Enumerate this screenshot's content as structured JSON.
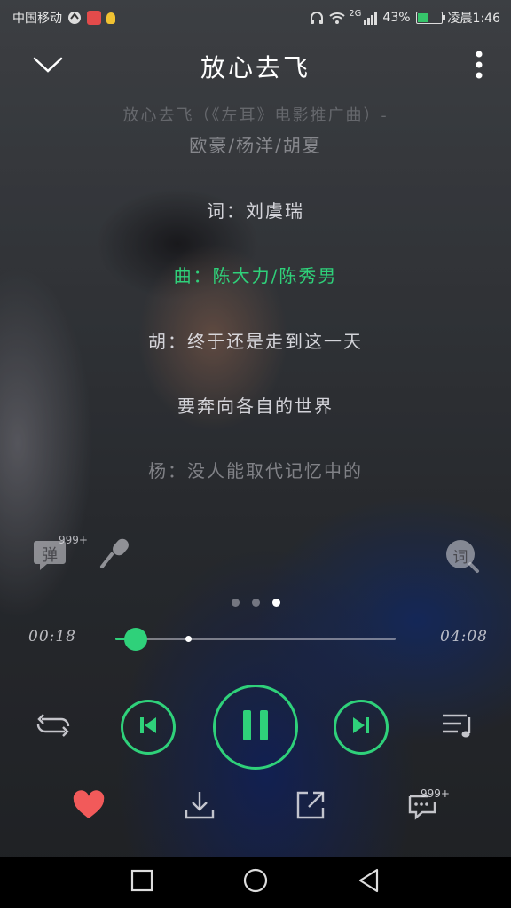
{
  "status_bar": {
    "carrier": "中国移动",
    "network": "2G",
    "battery_text": "43%",
    "battery_level": 0.43,
    "time": "凌晨1:46"
  },
  "header": {
    "title": "放心去飞"
  },
  "lyrics": [
    {
      "text": "放心去飞（《左耳》电影推广曲）-",
      "state": "faded"
    },
    {
      "text": "欧豪/杨洋/胡夏",
      "state": "dim2"
    },
    {
      "text": "词：刘虞瑞",
      "state": "normal"
    },
    {
      "text": "曲：陈大力/陈秀男",
      "state": "active"
    },
    {
      "text": "胡：终于还是走到这一天",
      "state": "normal"
    },
    {
      "text": "要奔向各自的世界",
      "state": "normal"
    },
    {
      "text": "杨：没人能取代记忆中的",
      "state": "dim2"
    }
  ],
  "mid_actions": {
    "danmu_label": "弹",
    "danmu_count": "999+",
    "lyric_search_label": "词"
  },
  "page_indicator": {
    "count": 3,
    "active": 2
  },
  "playback": {
    "elapsed": "00:18",
    "duration": "04:08",
    "progress": 0.073,
    "buffered": 0.26
  },
  "comments_count": "999+",
  "colors": {
    "accent": "#2fd17a",
    "heart": "#f25a5a"
  },
  "icons": [
    "chevron-down-icon",
    "more-vertical-icon",
    "danmu-icon",
    "microphone-icon",
    "lyric-search-icon",
    "repeat-icon",
    "previous-icon",
    "pause-icon",
    "next-icon",
    "playlist-icon",
    "heart-icon",
    "download-icon",
    "share-icon",
    "comment-icon",
    "nav-recents-icon",
    "nav-home-icon",
    "nav-back-icon"
  ]
}
